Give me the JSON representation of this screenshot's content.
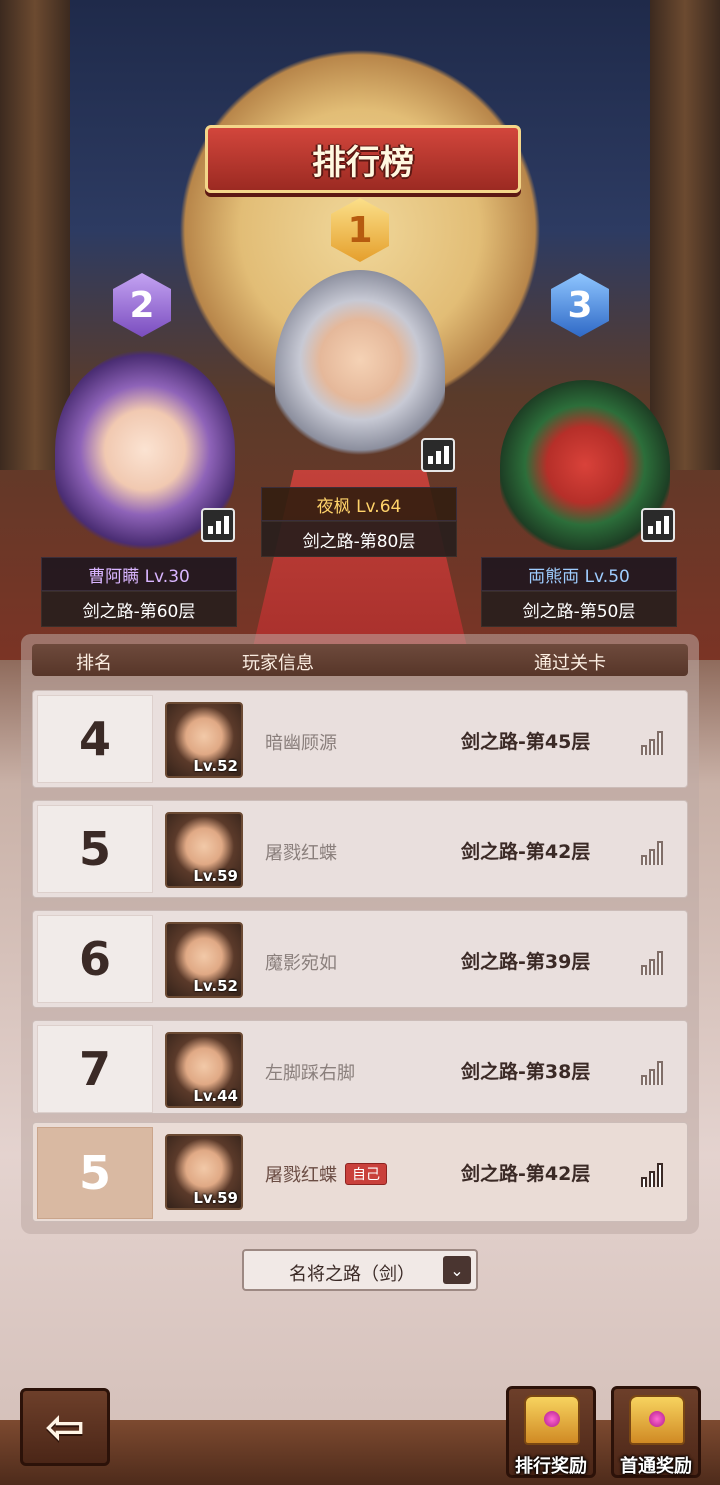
{
  "title": "排行榜",
  "top3": [
    {
      "rank": "1",
      "name": "夜枫 Lv.64",
      "stage": "剑之路-第80层"
    },
    {
      "rank": "2",
      "name": "曹阿瞒 Lv.30",
      "stage": "剑之路-第60层"
    },
    {
      "rank": "3",
      "name": "両熊両 Lv.50",
      "stage": "剑之路-第50层"
    }
  ],
  "list_header": {
    "rank": "排名",
    "player": "玩家信息",
    "stage": "通过关卡"
  },
  "rows": [
    {
      "rank": "4",
      "level": "Lv.52",
      "name": "暗幽顾源",
      "stage": "剑之路-第45层"
    },
    {
      "rank": "5",
      "level": "Lv.59",
      "name": "屠戮红蝶",
      "stage": "剑之路-第42层"
    },
    {
      "rank": "6",
      "level": "Lv.52",
      "name": "魔影宛如",
      "stage": "剑之路-第39层"
    },
    {
      "rank": "7",
      "level": "Lv.44",
      "name": "左脚踩右脚",
      "stage": "剑之路-第38层"
    }
  ],
  "self_row": {
    "rank": "5",
    "level": "Lv.59",
    "name": "屠戮红蝶",
    "tag": "自己",
    "stage": "剑之路-第42层"
  },
  "dropdown": {
    "selected": "名将之路（剑）",
    "arrow": "chevron-down-icon"
  },
  "buttons": {
    "back": "back-arrow-icon",
    "rank_reward": "排行奖励",
    "first_clear_reward": "首通奖励"
  }
}
